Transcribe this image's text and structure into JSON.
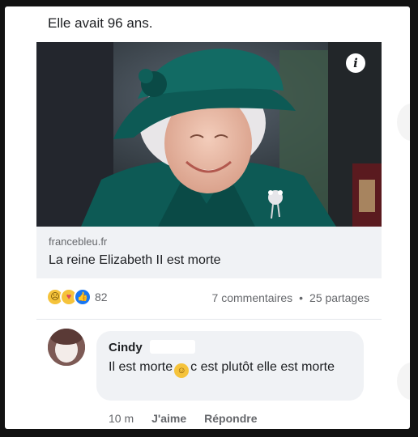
{
  "post": {
    "text": "Elle avait 96 ans."
  },
  "link_preview": {
    "domain": "francebleu.fr",
    "title": "La reine Elizabeth II est morte",
    "info_icon": "i"
  },
  "reactions": {
    "icons": [
      "sad-react-icon",
      "care-react-icon",
      "like-react-icon"
    ],
    "count": "82"
  },
  "stats": {
    "comments": "7 commentaires",
    "separator": "•",
    "shares": "25 partages"
  },
  "comment": {
    "author": "Cindy",
    "text_before": "Il est morte",
    "text_after": "c est plutôt elle est morte",
    "time": "10 m",
    "like": "J'aime",
    "reply": "Répondre"
  },
  "colors": {
    "hat_coat": "#0d5a55",
    "text": "#1c1e21",
    "secondary": "#65676b",
    "link_bg": "#f0f2f5"
  }
}
